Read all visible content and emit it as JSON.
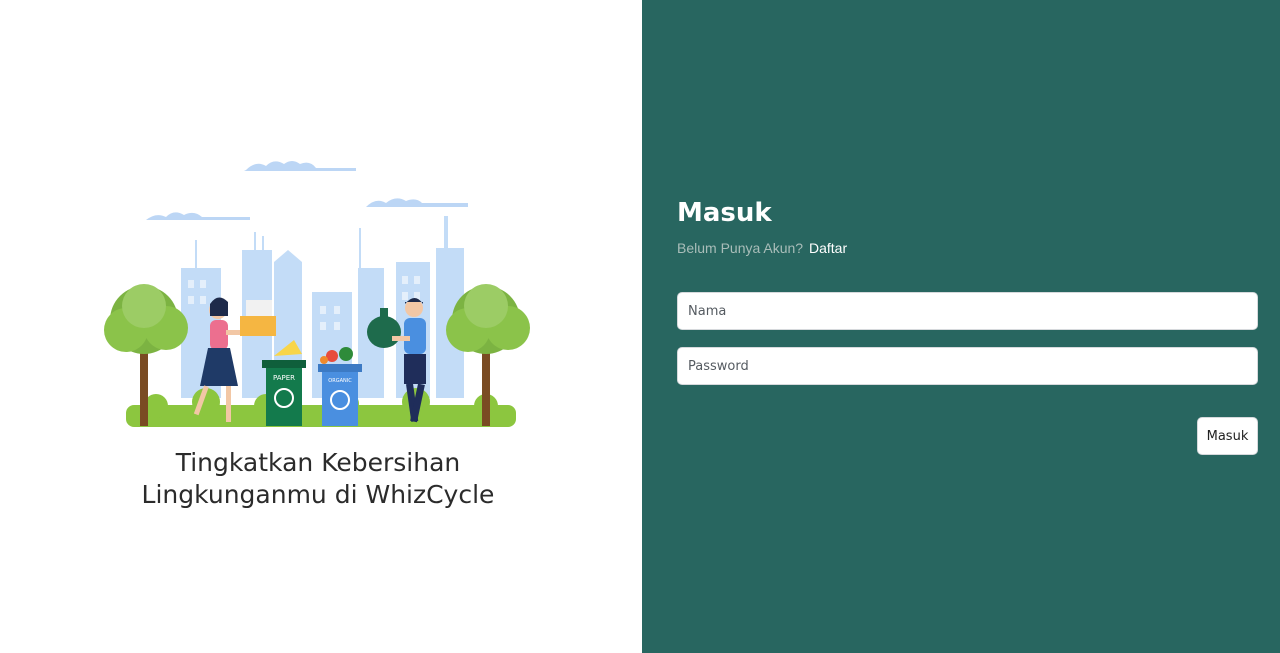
{
  "hero": {
    "tagline_line1": "Tingkatkan Kebersihan",
    "tagline_line2": "Lingkunganmu di WhizCycle",
    "bin_paper_label": "PAPER",
    "bin_organic_label": "ORGANIC"
  },
  "login": {
    "title": "Masuk",
    "no_account_text": "Belum Punya Akun?",
    "register_link": "Daftar",
    "name_placeholder": "Nama",
    "password_placeholder": "Password",
    "submit_label": "Masuk"
  },
  "colors": {
    "panel_bg": "#286660",
    "left_bg": "#ffffff"
  }
}
